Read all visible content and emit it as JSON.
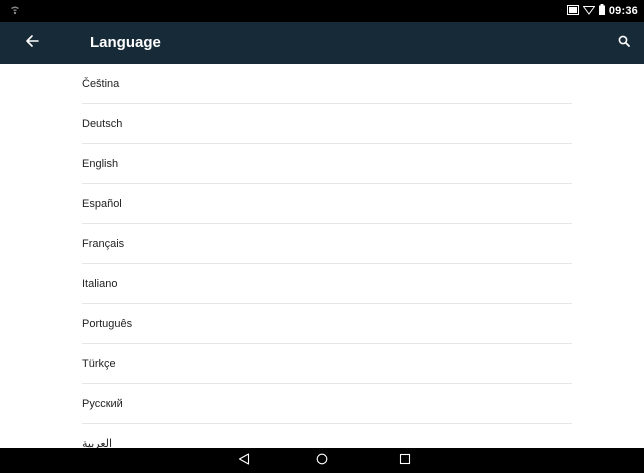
{
  "status_bar": {
    "time": "09:36"
  },
  "app_bar": {
    "title": "Language",
    "back_icon": "arrow-left-icon",
    "search_icon": "search-icon"
  },
  "languages": [
    "Čeština",
    "Deutsch",
    "English",
    "Español",
    "Français",
    "Italiano",
    "Português",
    "Türkçe",
    "Русский",
    "العربية"
  ],
  "nav_bar": {
    "back_icon": "triangle-back-icon",
    "home_icon": "circle-home-icon",
    "recents_icon": "square-recents-icon"
  },
  "colors": {
    "app_bar": "#172a37",
    "status_bar": "#000000",
    "divider": "#e6e6e6"
  }
}
